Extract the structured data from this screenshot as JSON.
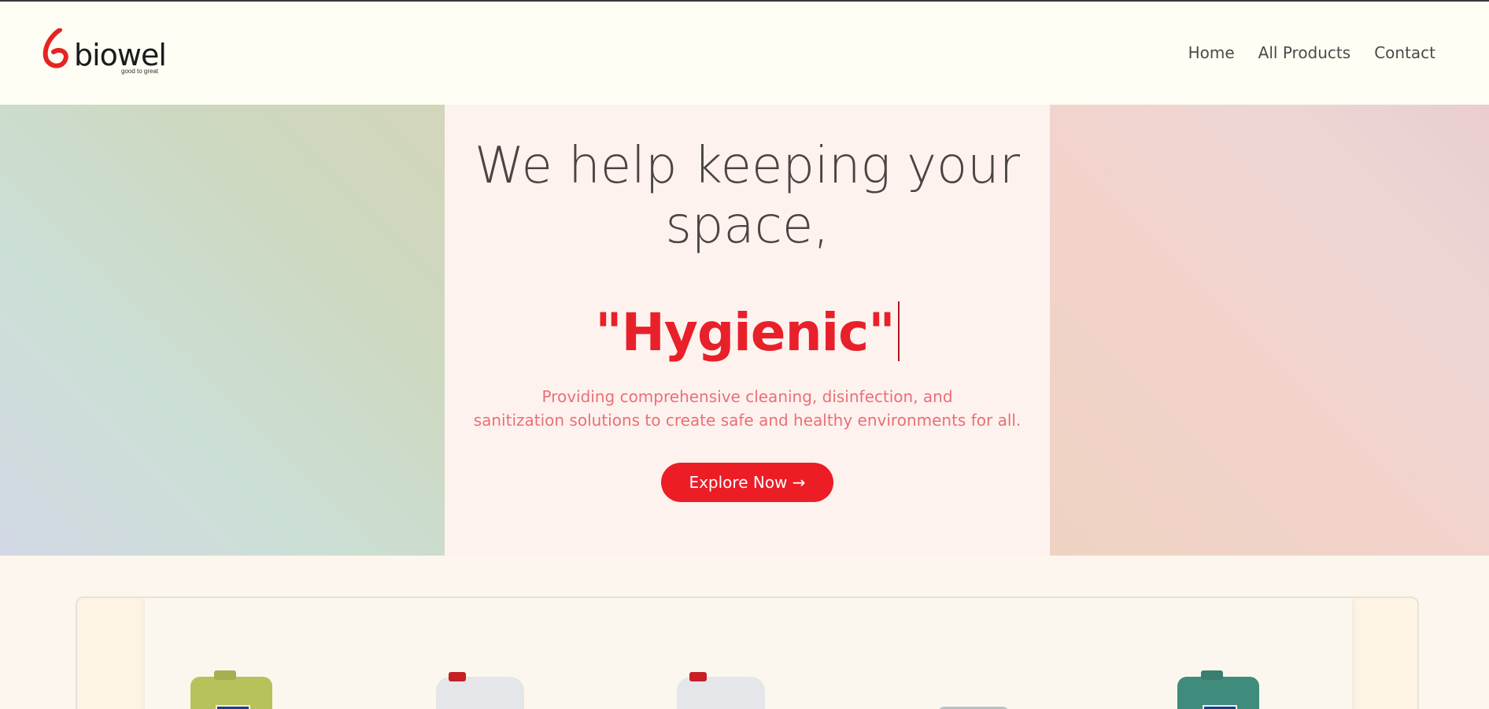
{
  "brand": {
    "name": "biowel",
    "tagline": "good to great",
    "logo_color": "#e52421"
  },
  "nav": {
    "items": [
      {
        "label": "Home"
      },
      {
        "label": "All Products"
      },
      {
        "label": "Contact"
      }
    ]
  },
  "hero": {
    "headline": "We help keeping your space,",
    "typed_word": "\"Hygienic\"",
    "subtext_line1": "Providing comprehensive cleaning, disinfection, and",
    "subtext_line2": "sanitization solutions to create safe and healthy environments for all.",
    "cta_label": "Explore Now →",
    "accent_color": "#ec1d25"
  },
  "products": {
    "items": [
      {
        "icon": "green-canister-icon",
        "color": "#b7c25a"
      },
      {
        "icon": "white-canister-icon",
        "color": "#e4e6e9"
      },
      {
        "icon": "white-canister-icon",
        "color": "#e4e6e9"
      },
      {
        "icon": "bowl-icon",
        "color": "#b8c3c7"
      },
      {
        "icon": "green-canister-icon",
        "color": "#3f8c7c"
      }
    ]
  }
}
